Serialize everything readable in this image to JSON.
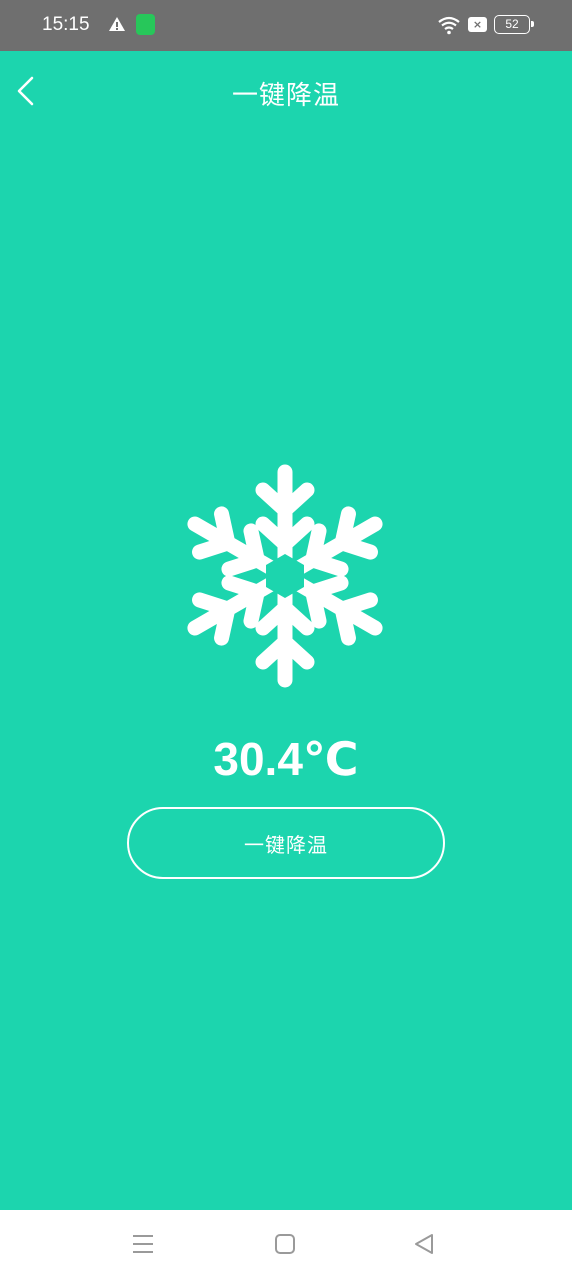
{
  "status_bar": {
    "time": "15:15",
    "battery_level": "52",
    "icons": [
      "warning-icon",
      "app-notification-icon",
      "wifi-icon",
      "no-sim-icon",
      "battery-icon"
    ]
  },
  "header": {
    "title": "一键降温",
    "back_icon": "chevron-left-icon"
  },
  "main": {
    "icon": "snowflake-icon",
    "temperature": "30.4℃",
    "cool_button_label": "一键降温"
  },
  "bottom_nav": {
    "icons": [
      "menu-icon",
      "home-icon",
      "back-triangle-icon"
    ]
  },
  "colors": {
    "background": "#1cd5ae",
    "status_bar": "#6f6f6f",
    "foreground": "#ffffff"
  }
}
